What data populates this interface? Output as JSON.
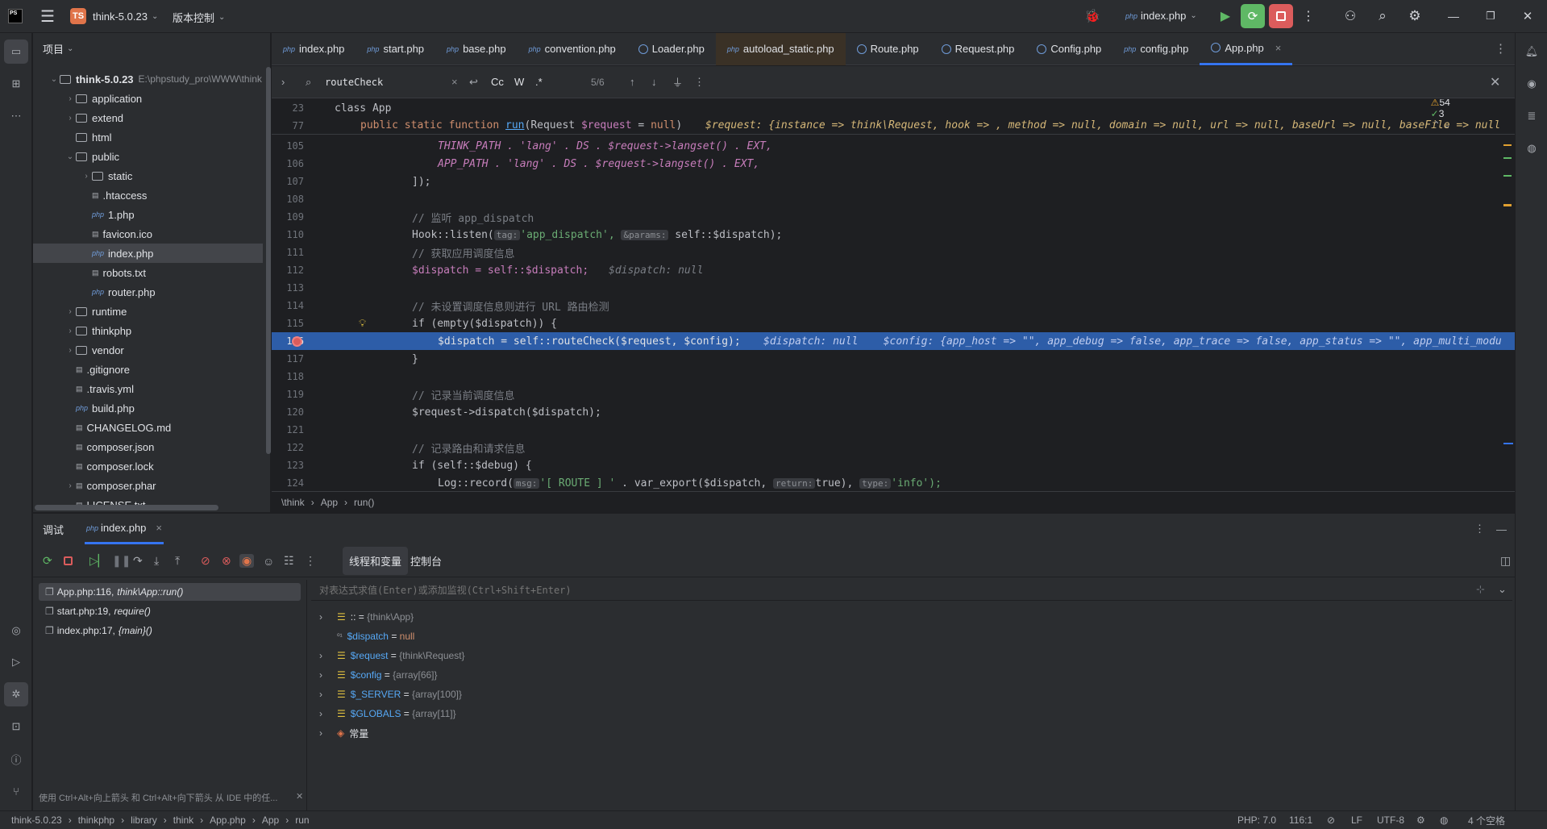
{
  "titlebar": {
    "project_badge": "TS",
    "project_name": "think-5.0.23",
    "vcs_label": "版本控制",
    "run_config": "index.php"
  },
  "project_panel": {
    "title": "项目",
    "root_name": "think-5.0.23",
    "root_path": "E:\\phpstudy_pro\\WWW\\think",
    "items": [
      {
        "label": "application",
        "kind": "folder"
      },
      {
        "label": "extend",
        "kind": "folder"
      },
      {
        "label": "html",
        "kind": "folder"
      },
      {
        "label": "public",
        "kind": "folder"
      },
      {
        "label": "static",
        "kind": "folder"
      },
      {
        "label": ".htaccess",
        "kind": "file"
      },
      {
        "label": "1.php",
        "kind": "php"
      },
      {
        "label": "favicon.ico",
        "kind": "file"
      },
      {
        "label": "index.php",
        "kind": "php"
      },
      {
        "label": "robots.txt",
        "kind": "file"
      },
      {
        "label": "router.php",
        "kind": "php"
      },
      {
        "label": "runtime",
        "kind": "folder"
      },
      {
        "label": "thinkphp",
        "kind": "folder"
      },
      {
        "label": "vendor",
        "kind": "folder"
      },
      {
        "label": ".gitignore",
        "kind": "file"
      },
      {
        "label": ".travis.yml",
        "kind": "file"
      },
      {
        "label": "build.php",
        "kind": "php"
      },
      {
        "label": "CHANGELOG.md",
        "kind": "file"
      },
      {
        "label": "composer.json",
        "kind": "file"
      },
      {
        "label": "composer.lock",
        "kind": "file"
      },
      {
        "label": "composer.phar",
        "kind": "file"
      },
      {
        "label": "LICENSE.txt",
        "kind": "file"
      }
    ]
  },
  "tabs": [
    {
      "label": "index.php"
    },
    {
      "label": "start.php"
    },
    {
      "label": "base.php"
    },
    {
      "label": "convention.php"
    },
    {
      "label": "Loader.php"
    },
    {
      "label": "autoload_static.php"
    },
    {
      "label": "Route.php"
    },
    {
      "label": "Request.php"
    },
    {
      "label": "Config.php"
    },
    {
      "label": "config.php"
    },
    {
      "label": "App.php"
    }
  ],
  "find": {
    "query": "routeCheck",
    "case_label": "Cc",
    "word_label": "W",
    "regex_label": ".*",
    "match_count": "5/6"
  },
  "inspections": {
    "warnings": "3",
    "weak_warnings": "54",
    "typos": "3"
  },
  "code": {
    "sticky1": {
      "num": "23",
      "text": "class App"
    },
    "sticky2": {
      "num": "77",
      "text": "public static function run(Request $request = null)",
      "inline": "$request: {instance => think\\Request, hook => , method => null, domain => null, url => null, baseUrl => null, baseFile => null"
    },
    "l105": {
      "num": "105",
      "text": "THINK_PATH . 'lang' . DS . $request->langset() . EXT,"
    },
    "l106": {
      "num": "106",
      "text": "APP_PATH . 'lang' . DS . $request->langset() . EXT,"
    },
    "l107": {
      "num": "107",
      "text": "]);"
    },
    "l108": {
      "num": "108"
    },
    "l109": {
      "num": "109",
      "text": "// 监听 app_dispatch"
    },
    "l110": {
      "num": "110",
      "pre": "Hook::listen(",
      "hint1": "tag:",
      "str": "'app_dispatch',",
      "hint2": "&params:",
      "post": "self::$dispatch);"
    },
    "l111": {
      "num": "111",
      "text": "// 获取应用调度信息"
    },
    "l112": {
      "num": "112",
      "text": "$dispatch = self::$dispatch;",
      "inline": "$dispatch: null"
    },
    "l113": {
      "num": "113"
    },
    "l114": {
      "num": "114",
      "text": "// 未设置调度信息则进行 URL 路由检测"
    },
    "l115": {
      "num": "115",
      "text": "if (empty($dispatch)) {"
    },
    "l116": {
      "num": "116",
      "text": "$dispatch = self::routeCheck($request, $config);",
      "inline": "$dispatch: null    $config: {app_host => \"\", app_debug => false, app_trace => false, app_status => \"\", app_multi_modu"
    },
    "l117": {
      "num": "117",
      "text": "}"
    },
    "l118": {
      "num": "118"
    },
    "l119": {
      "num": "119",
      "text": "// 记录当前调度信息"
    },
    "l120": {
      "num": "120",
      "text": "$request->dispatch($dispatch);"
    },
    "l121": {
      "num": "121"
    },
    "l122": {
      "num": "122",
      "text": "// 记录路由和请求信息"
    },
    "l123": {
      "num": "123",
      "text": "if (self::$debug) {"
    },
    "l124": {
      "num": "124",
      "pre": "Log::record(",
      "hint1": "msg:",
      "str": "'[ ROUTE ] '",
      "mid": " . var_export($dispatch, ",
      "hint2": "return:",
      "mid2": "true), ",
      "hint3": "type:",
      "str2": "'info');"
    }
  },
  "breadcrumbs": [
    "\\think",
    "App",
    "run()"
  ],
  "debug": {
    "tab_debug": "调试",
    "tab_session": "index.php",
    "tab_threads": "线程和变量",
    "tab_console": "控制台",
    "eval_placeholder": "对表达式求值(Enter)或添加监视(Ctrl+Shift+Enter)",
    "frames": [
      {
        "file": "App.php:116,",
        "func": "think\\App::run()"
      },
      {
        "file": "start.php:19,",
        "func": "require()"
      },
      {
        "file": "index.php:17,",
        "func": "{main}()"
      }
    ],
    "frames_hint": "使用 Ctrl+Alt+向上箭头 和 Ctrl+Alt+向下箭头 从 IDE 中的任...",
    "vars": [
      {
        "name": "::",
        "eq": " = ",
        "value": "{think\\App}",
        "expandable": true
      },
      {
        "name": "$dispatch",
        "eq": " = ",
        "value": "null",
        "expandable": false
      },
      {
        "name": "$request",
        "eq": " = ",
        "value": "{think\\Request}",
        "expandable": true
      },
      {
        "name": "$config",
        "eq": " = ",
        "value": "{array[66]}",
        "expandable": true
      },
      {
        "name": "$_SERVER",
        "eq": " = ",
        "value": "{array[100]}",
        "expandable": true
      },
      {
        "name": "$GLOBALS",
        "eq": " = ",
        "value": "{array[11]}",
        "expandable": true
      },
      {
        "name": "常量",
        "eq": "",
        "value": "",
        "expandable": true
      }
    ]
  },
  "statusbar": {
    "path": [
      "think-5.0.23",
      "thinkphp",
      "library",
      "think",
      "App.php",
      "App",
      "run"
    ],
    "php_version": "PHP: 7.0",
    "position": "116:1",
    "line_sep": "LF",
    "encoding": "UTF-8",
    "indent": "4 个空格"
  },
  "colors": {
    "accent": "#3574f0",
    "run_green": "#5fb865",
    "stop_red": "#db5c5c",
    "badge_orange": "#e0744a"
  }
}
